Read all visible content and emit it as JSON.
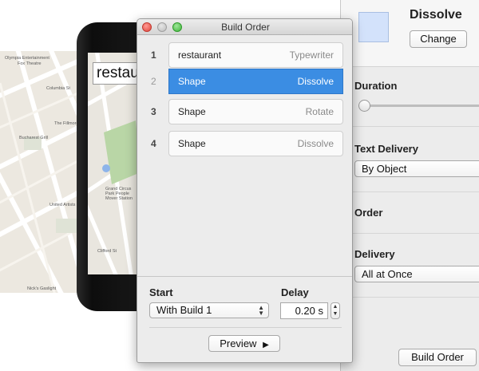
{
  "canvas": {
    "phone_text": "restaurant",
    "map_labels": [
      "Olympia Entertainment",
      "Fox Theatre",
      "Columbia St",
      "The Fillmore Detroit",
      "Bucharest Grill",
      "Grand Circus Park People Mover Station",
      "United Artists Theatre Building",
      "Clifford St",
      "Washington Blvd",
      "Nick's Gaslight",
      "Middle St",
      "Bagley Ave",
      "Park Ave",
      "Grand Ave",
      "Elizabeth St",
      "Grand River Ave"
    ]
  },
  "build_order_window": {
    "title": "Build Order",
    "items": [
      {
        "number": "1",
        "name": "restaurant",
        "effect": "Typewriter",
        "selected": false
      },
      {
        "number": "2",
        "name": "Shape",
        "effect": "Dissolve",
        "selected": true
      },
      {
        "number": "3",
        "name": "Shape",
        "effect": "Rotate",
        "selected": false
      },
      {
        "number": "4",
        "name": "Shape",
        "effect": "Dissolve",
        "selected": false
      }
    ],
    "start_label": "Start",
    "start_value": "With Build 1",
    "delay_label": "Delay",
    "delay_value": "0.20 s",
    "preview_label": "Preview"
  },
  "inspector": {
    "effect_name": "Dissolve",
    "change_label": "Change",
    "duration_label": "Duration",
    "duration_level": 0.0,
    "text_delivery_label": "Text Delivery",
    "text_delivery_value": "By Object",
    "order_label": "Order",
    "delivery_label": "Delivery",
    "delivery_value": "All at Once",
    "build_order_label": "Build Order",
    "colors": {
      "swatch": "#d3e2fb",
      "selection": "#3b8de3"
    }
  }
}
